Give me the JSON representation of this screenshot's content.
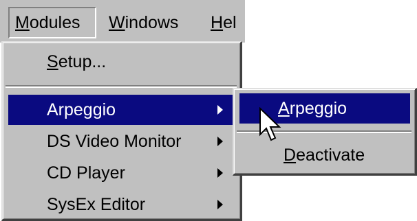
{
  "menubar": {
    "items": [
      {
        "label": "Modules",
        "mnemonic": "M"
      },
      {
        "label": "Windows",
        "mnemonic": "W"
      },
      {
        "label": "Hel",
        "mnemonic": "H"
      }
    ]
  },
  "modules_menu": {
    "setup": {
      "label": "Setup...",
      "mnemonic": "S"
    },
    "items": [
      {
        "label": "Arpeggio"
      },
      {
        "label": "DS Video Monitor"
      },
      {
        "label": "CD Player"
      },
      {
        "label": "SysEx Editor"
      }
    ]
  },
  "submenu": {
    "items": [
      {
        "label": "Arpeggio",
        "mnemonic": "A"
      },
      {
        "label": "Deactivate",
        "mnemonic": "D"
      }
    ]
  },
  "colors": {
    "menu_face": "#c0c0c0",
    "highlight": "#0a0a80",
    "highlight_text": "#ffffff"
  },
  "icons": {
    "submenu_arrow": "right-triangle",
    "pointer": "arrow-cursor"
  }
}
